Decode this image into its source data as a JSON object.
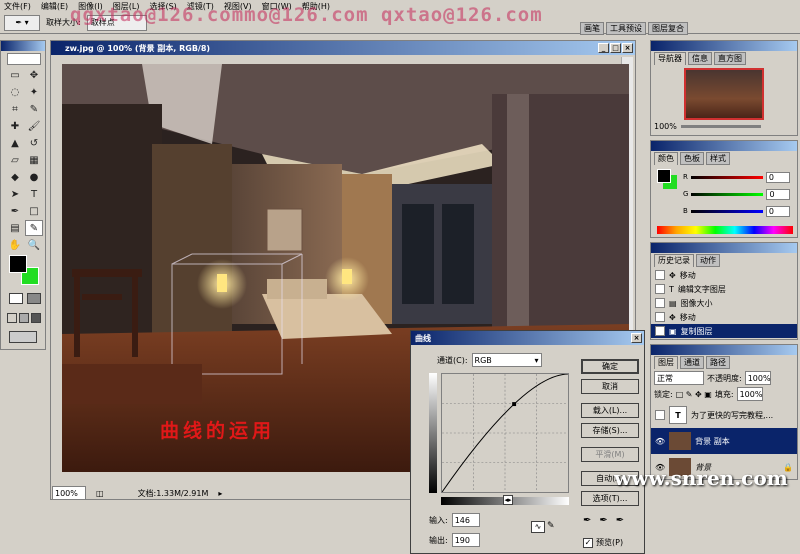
{
  "menu": [
    "文件(F)",
    "编辑(E)",
    "图像(I)",
    "图层(L)",
    "选择(S)",
    "滤镜(T)",
    "视图(V)",
    "窗口(W)",
    "帮助(H)"
  ],
  "options": {
    "sample_label": "取样大小:",
    "sample_value": "取样点"
  },
  "watermark": "qgxtao@126.commo@126.com qxtao@126.com",
  "palette_well": [
    "画笔",
    "工具预设",
    "图层复合"
  ],
  "document": {
    "title": "zw.jpg @ 100% (背景 副本, RGB/8)",
    "zoom": "100%",
    "doc_info": "文档:1.33M/2.91M"
  },
  "caption": "曲线的运用",
  "site": "www.snren.com",
  "navigator": {
    "tabs": [
      "导航器",
      "信息",
      "直方图"
    ],
    "zoom": "100%"
  },
  "color": {
    "tabs": [
      "颜色",
      "色板",
      "样式"
    ],
    "r": "0",
    "g": "0",
    "b": "0"
  },
  "history": {
    "tabs": [
      "历史记录",
      "动作"
    ],
    "items": [
      "移动",
      "编辑文字图层",
      "图像大小",
      "移动",
      "复制图层"
    ]
  },
  "layers": {
    "tabs": [
      "图层",
      "通道",
      "路径"
    ],
    "blend": "正常",
    "opacity_label": "不透明度:",
    "opacity": "100%",
    "lock_label": "锁定:",
    "fill_label": "填充:",
    "fill": "100%",
    "items": [
      {
        "name": "为了更快的写完教程,..."
      },
      {
        "name": "背景 副本"
      },
      {
        "name": "背景"
      }
    ]
  },
  "curves": {
    "title": "曲线",
    "channel_label": "通道(C):",
    "channel": "RGB",
    "ok": "确定",
    "cancel": "取消",
    "load": "载入(L)...",
    "save": "存储(S)...",
    "smooth": "平滑(M)",
    "auto": "自动(A)",
    "options": "选项(T)...",
    "input_label": "输入:",
    "input": "146",
    "output_label": "输出:",
    "output": "190",
    "preview": "预览(P)",
    "point_in": 146,
    "point_out": 190
  },
  "colors": {
    "titlebar": "#0a246a",
    "caption": "#e01818",
    "fg": "#000000",
    "bg": "#22dd22"
  }
}
